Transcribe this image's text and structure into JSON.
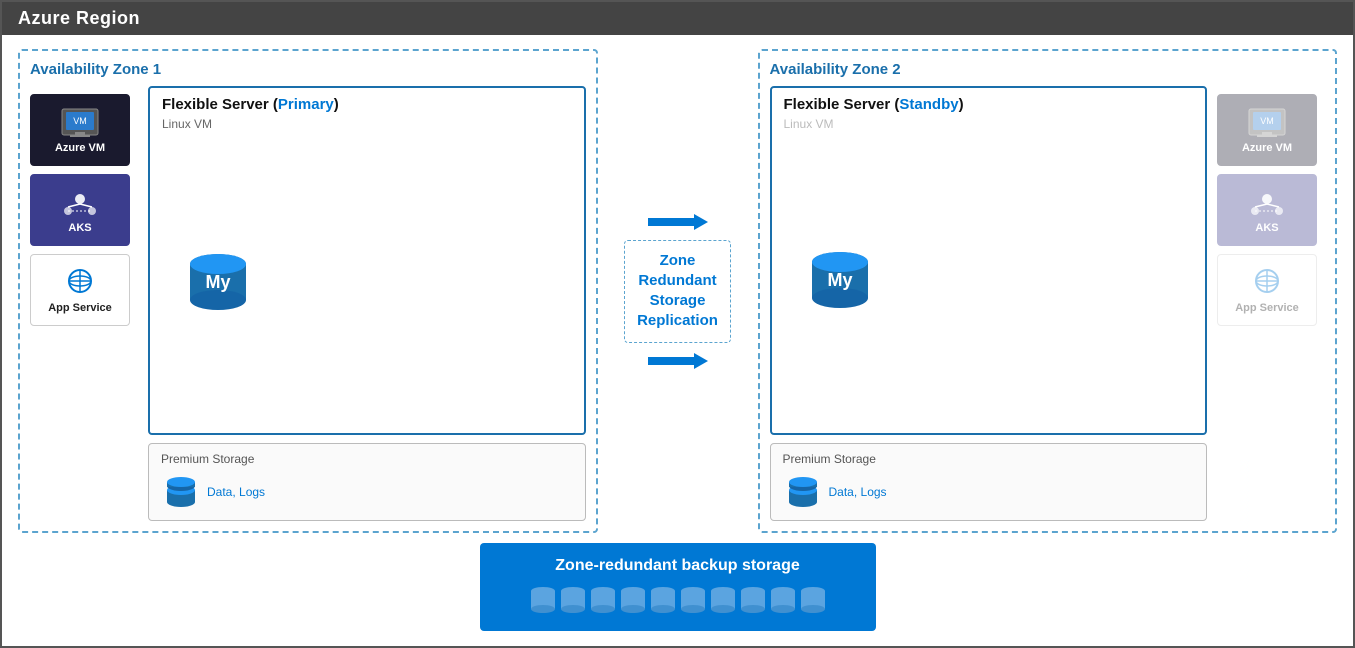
{
  "header": {
    "title": "Azure Region",
    "bg_color": "#444444"
  },
  "zone1": {
    "label": "Availability Zone 1",
    "flexible_server_title": "Flexible Server (",
    "flexible_server_primary": "Primary",
    "flexible_server_close": ")",
    "linux_vm_label": "Linux VM",
    "premium_storage_label": "Premium Storage",
    "data_logs_label": "Data, Logs",
    "services": [
      {
        "name": "Azure VM",
        "type": "dark"
      },
      {
        "name": "AKS",
        "type": "purple"
      },
      {
        "name": "App Service",
        "type": "white"
      }
    ]
  },
  "zone2": {
    "label": "Availability Zone 2",
    "flexible_server_title": "Flexible Server (",
    "flexible_server_standby": "Standby",
    "flexible_server_close": ")",
    "linux_vm_label": "Linux VM",
    "premium_storage_label": "Premium Storage",
    "data_logs_label": "Data, Logs",
    "services": [
      {
        "name": "Azure VM",
        "type": "dark"
      },
      {
        "name": "AKS",
        "type": "purple"
      },
      {
        "name": "App Service",
        "type": "white"
      }
    ]
  },
  "zrs": {
    "label": "Zone\nRedundant\nStorage\nReplication"
  },
  "backup": {
    "title": "Zone-redundant backup storage"
  }
}
